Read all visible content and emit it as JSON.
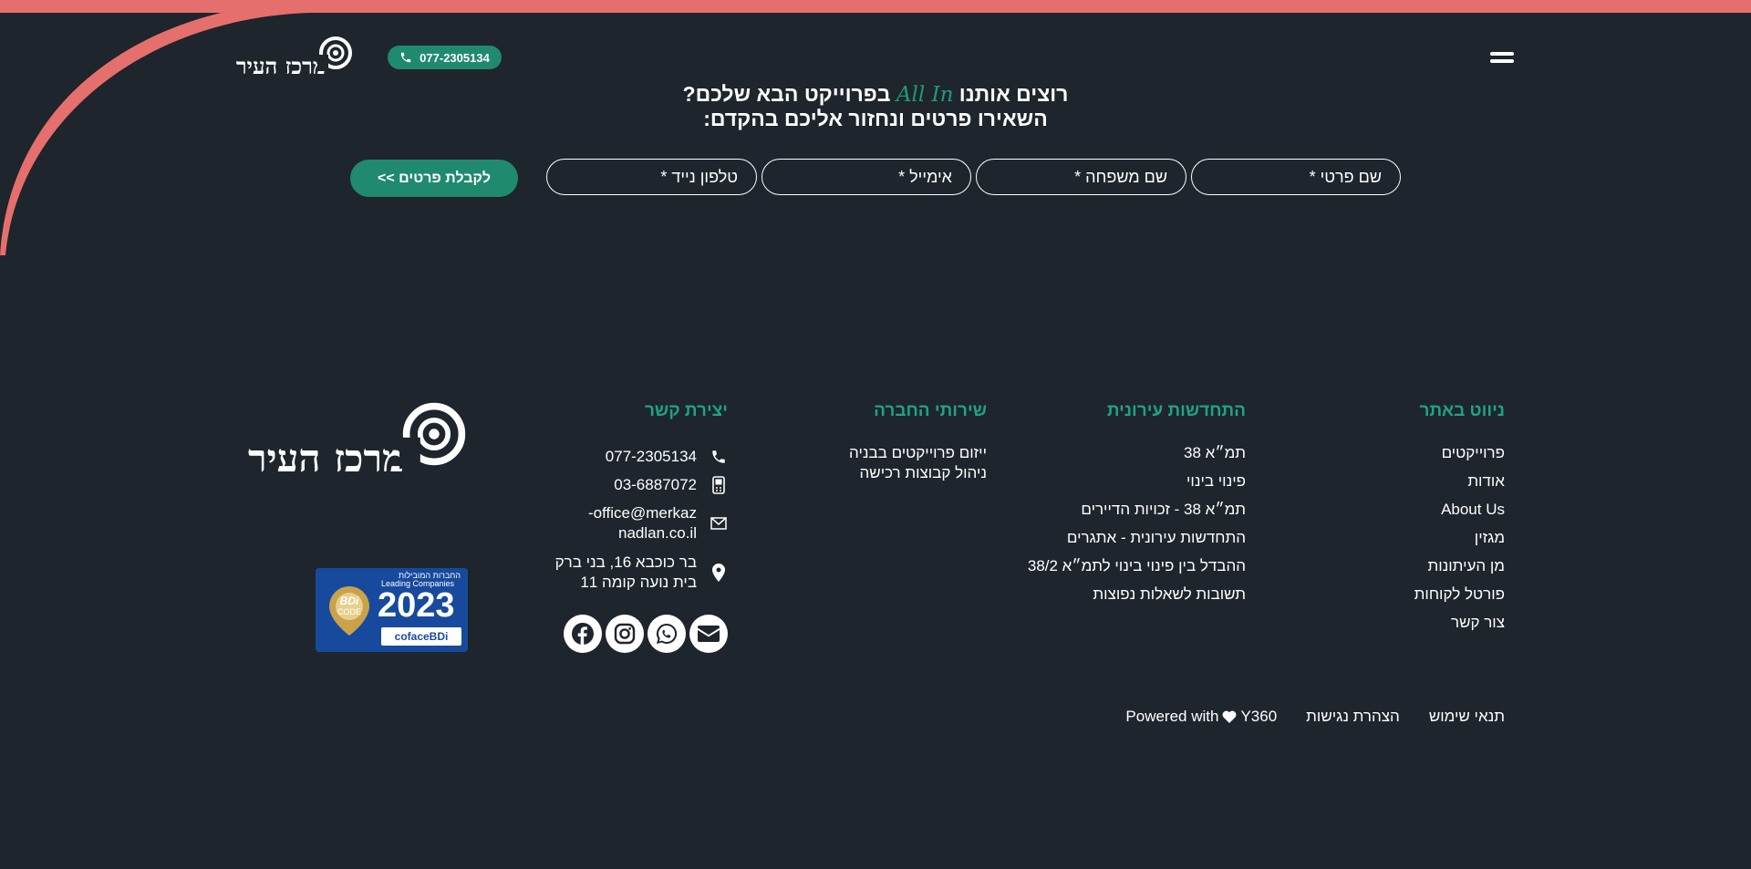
{
  "brand": {
    "logo_text": "מרכז העיר"
  },
  "header": {
    "phone": "077-2305134",
    "cta_line1_before": "רוצים אותנו",
    "cta_allin": "All In",
    "cta_line1_after": "בפרוייקט הבא שלכם?",
    "cta_line2": "השאירו פרטים ונחזור אליכם בהקדם:"
  },
  "form": {
    "first_name_placeholder": "שם פרטי *",
    "last_name_placeholder": "שם משפחה *",
    "email_placeholder": "אימייל *",
    "phone_placeholder": "טלפון נייד *",
    "submit_label": "לקבלת פרטים >>"
  },
  "footer": {
    "nav": {
      "title": "ניווט באתר",
      "items": [
        "פרוייקטים",
        "אודות",
        "About Us",
        "מגזין",
        "מן העיתונות",
        "פורטל לקוחות",
        "צור קשר"
      ]
    },
    "urban": {
      "title": "התחדשות עירונית",
      "items": [
        "תמ״א 38",
        "פינוי בינוי",
        "תמ״א 38 - זכויות הדיירים",
        "התחדשות עירונית - אתגרים",
        "ההבדל בין פינוי בינוי לתמ״א 38/2",
        "תשובות לשאלות נפוצות"
      ]
    },
    "services": {
      "title": "שירותי החברה",
      "items": [
        "ייזום פרוייקטים בבניה",
        "ניהול קבוצות רכישה"
      ]
    },
    "contact": {
      "title": "יצירת קשר",
      "phone1": "077-2305134",
      "phone2": "03-6887072",
      "email_line1": "office@merkaz-",
      "email_line2": "nadlan.co.il",
      "address_line1": "בר כוכבא 16, בני ברק",
      "address_line2": "בית נועה קומה 11"
    },
    "badge": {
      "top_text": "החברות המובילות",
      "subtitle": "Leading Companies",
      "seal_line1": "BDi",
      "seal_line2": "CODE",
      "year": "2023",
      "brand": "cofaceBDi"
    },
    "bottom": {
      "terms": "תנאי שימוש",
      "accessibility": "הצהרת נגישות",
      "powered_prefix": "Powered with",
      "powered_suffix": "Y360"
    }
  },
  "colors": {
    "accent": "#1f8a6d",
    "accent_text": "#1fa383",
    "top_bar": "#e56f6c",
    "background": "#1e252c"
  }
}
